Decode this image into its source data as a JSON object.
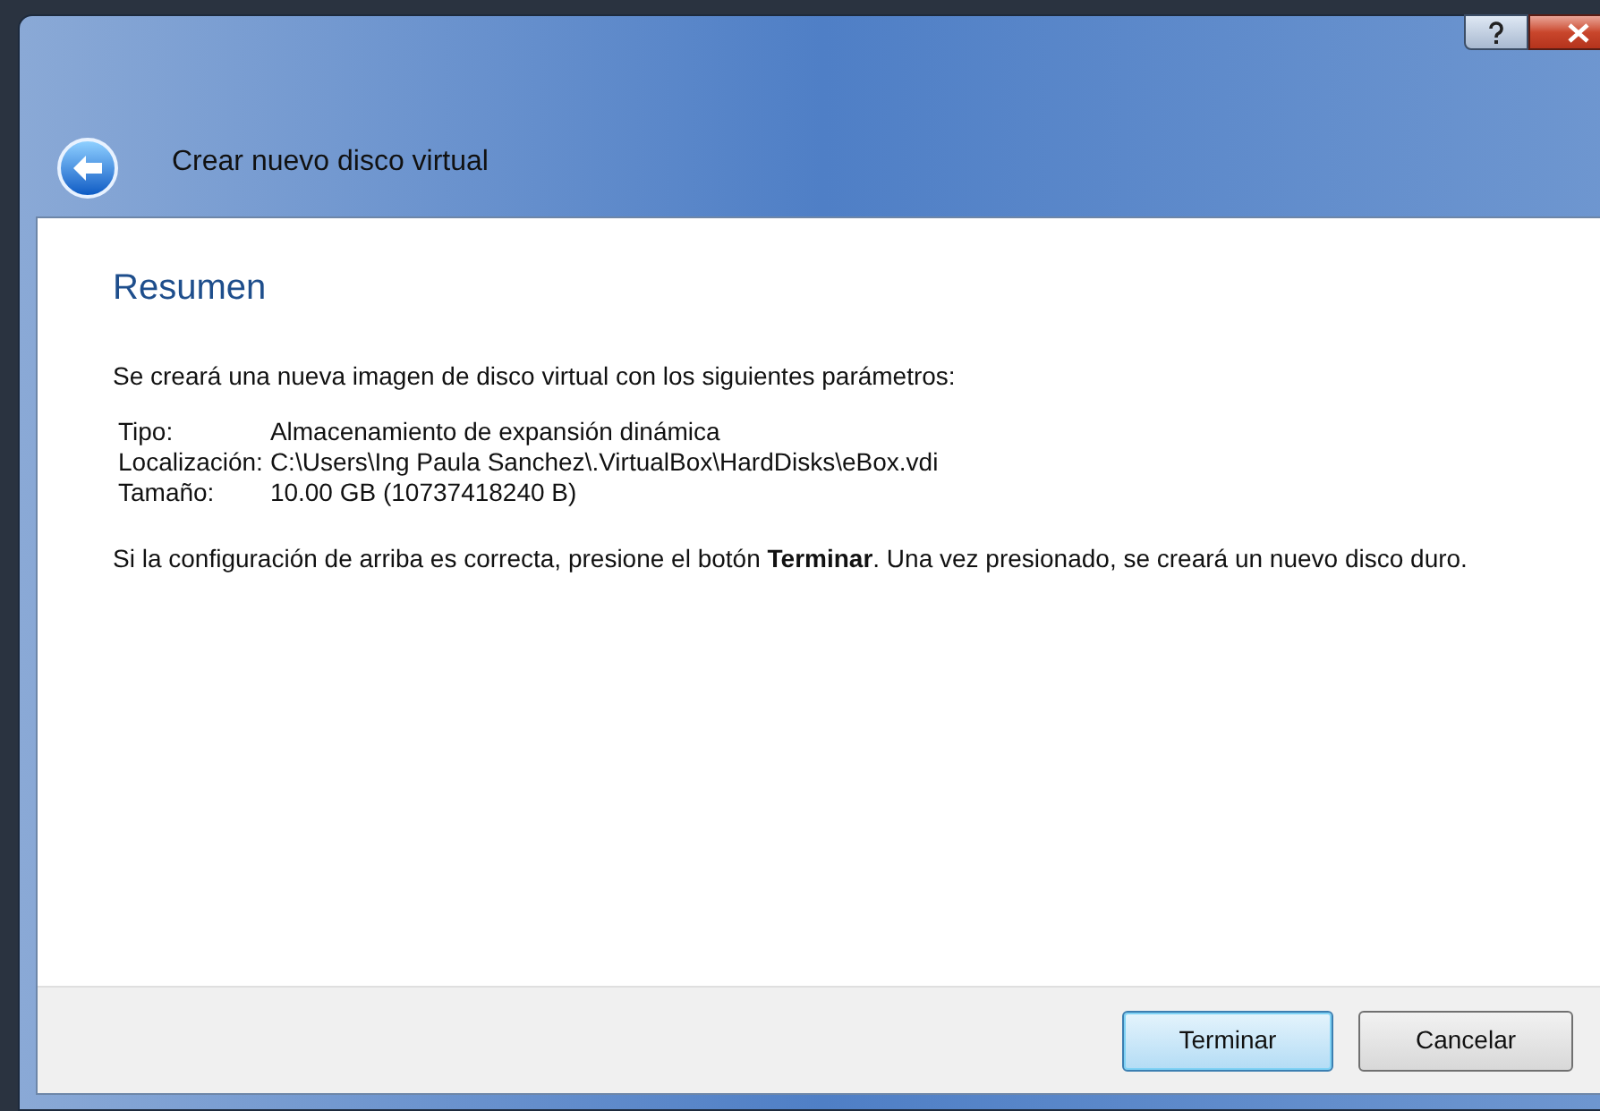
{
  "window": {
    "title": "Crear nuevo disco virtual"
  },
  "page": {
    "heading": "Resumen",
    "intro": "Se creará una nueva imagen de disco virtual con los siguientes parámetros:",
    "parameters": [
      {
        "label": "Tipo:",
        "value": "Almacenamiento de expansión dinámica"
      },
      {
        "label": "Localización:",
        "value": "C:\\Users\\Ing Paula Sanchez\\.VirtualBox\\HardDisks\\eBox.vdi"
      },
      {
        "label": "Tamaño:",
        "value": "10.00 GB (10737418240 B)"
      }
    ],
    "note": "Si la configuración de arriba es correcta, presione el botón **Terminar**. Una vez presionado, se creará un nuevo disco duro."
  },
  "buttons": [
    {
      "label": "Terminar",
      "default": true
    },
    {
      "label": "Cancelar",
      "default": false
    }
  ]
}
